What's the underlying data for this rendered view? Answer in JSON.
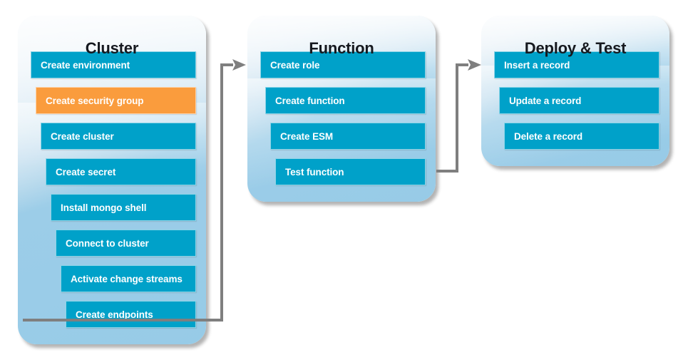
{
  "diagram": {
    "title_visible": false,
    "colors": {
      "step_blue": "#00a1c9",
      "step_highlight_orange": "#fa9c3d",
      "panel_light": "#eef4f9",
      "panel_mid": "#97cbe7",
      "connector_gray": "#7f7f7f",
      "title_text": "#16191f",
      "step_text": "#ffffff"
    }
  },
  "panels": [
    {
      "id": "cluster",
      "title": "Cluster",
      "steps": [
        {
          "label": "Create environment",
          "highlight": false
        },
        {
          "label": "Create security group",
          "highlight": true
        },
        {
          "label": "Create cluster",
          "highlight": false
        },
        {
          "label": "Create secret",
          "highlight": false
        },
        {
          "label": "Install mongo shell",
          "highlight": false
        },
        {
          "label": "Connect to cluster",
          "highlight": false
        },
        {
          "label": "Activate change streams",
          "highlight": false
        },
        {
          "label": "Create endpoints",
          "highlight": false
        }
      ]
    },
    {
      "id": "function",
      "title": "Function",
      "steps": [
        {
          "label": "Create role",
          "highlight": false
        },
        {
          "label": "Create function",
          "highlight": false
        },
        {
          "label": "Create ESM",
          "highlight": false
        },
        {
          "label": "Test function",
          "highlight": false
        }
      ]
    },
    {
      "id": "deploy-test",
      "title": "Deploy & Test",
      "steps": [
        {
          "label": "Insert a record",
          "highlight": false
        },
        {
          "label": "Update a record",
          "highlight": false
        },
        {
          "label": "Delete a record",
          "highlight": false
        }
      ]
    }
  ],
  "connectors": [
    {
      "id": "cluster-to-function",
      "from": "cluster",
      "to": "function",
      "arrow": "arrow-right-icon"
    },
    {
      "id": "function-to-deploytest",
      "from": "function",
      "to": "deploy-test",
      "arrow": "arrow-right-icon"
    }
  ]
}
